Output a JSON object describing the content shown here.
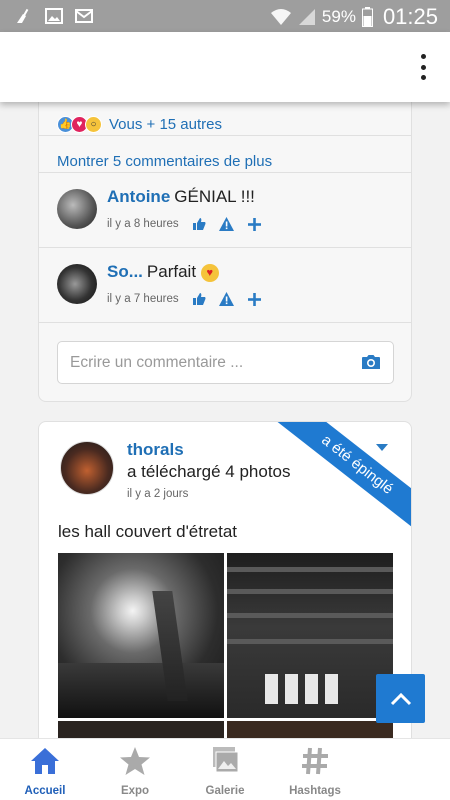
{
  "status_bar": {
    "battery": "59%",
    "time": "01:25"
  },
  "feed": {
    "reactions_text": "Vous + 15 autres",
    "show_more_comments": "Montrer 5 commentaires de plus",
    "comments": [
      {
        "author": "Antoine",
        "text": "GÉNIAL !!!",
        "time": "il y a 8 heures"
      },
      {
        "author": "So...",
        "text": "Parfait",
        "time": "il y a 7 heures"
      }
    ],
    "comment_placeholder": "Ecrire un commentaire ...",
    "post": {
      "author": "thorals",
      "action": "a téléchargé 4 photos",
      "time": "il y a 2 jours",
      "pinned": "a été épinglé",
      "text": "les hall couvert d'étretat"
    }
  },
  "bottom_nav": [
    {
      "label": "Accueil",
      "active": true
    },
    {
      "label": "Expo",
      "active": false
    },
    {
      "label": "Galerie",
      "active": false
    },
    {
      "label": "Hashtags",
      "active": false
    }
  ],
  "colors": {
    "accent": "#1f7ad1",
    "link": "#1f6fb5",
    "status_bar": "#9e9e9e"
  }
}
